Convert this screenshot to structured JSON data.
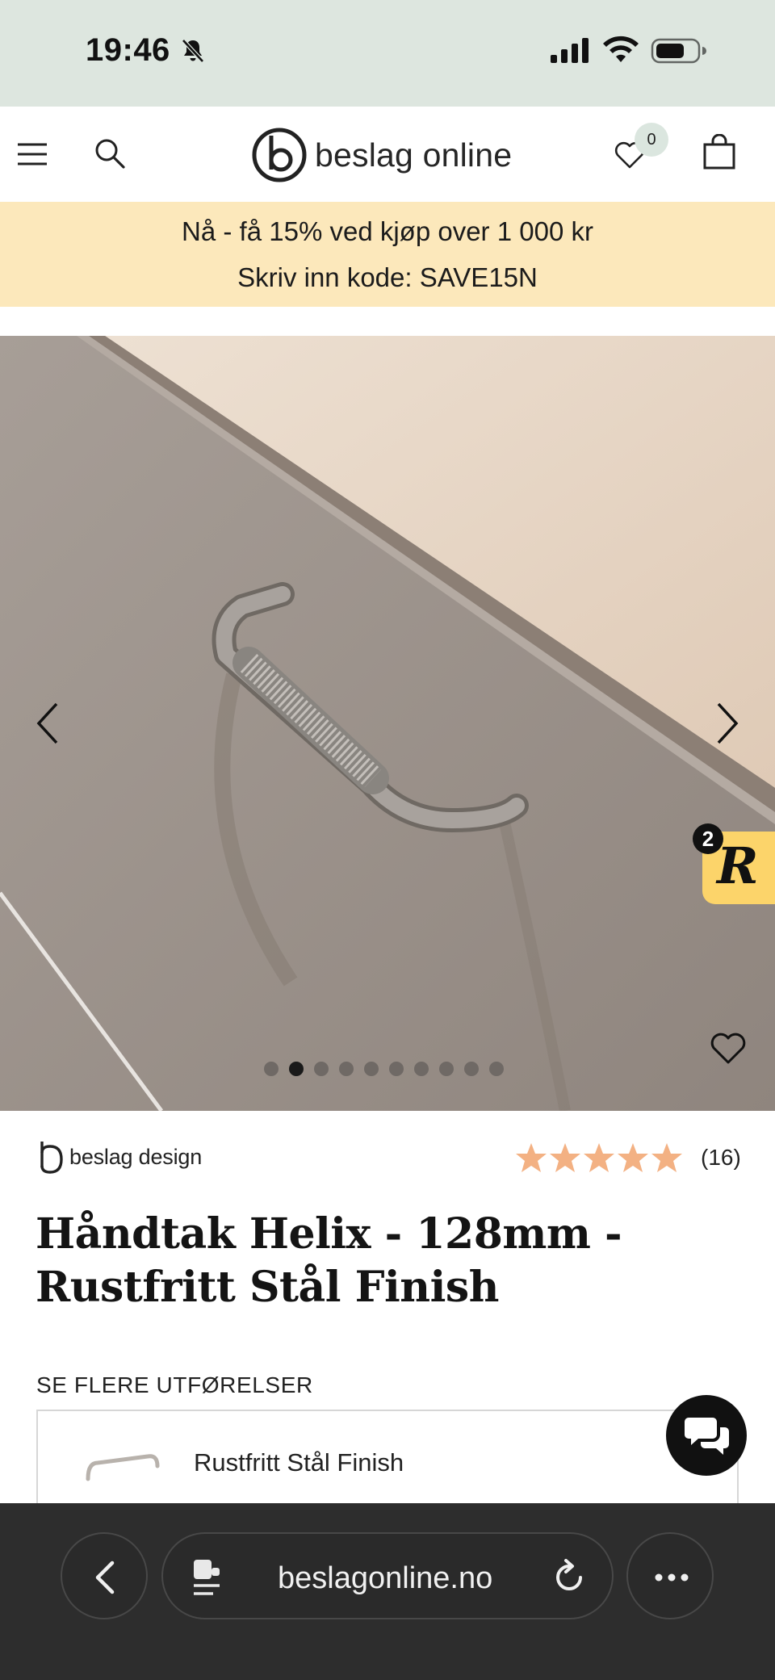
{
  "status_bar": {
    "time": "19:46"
  },
  "header": {
    "logo_text": "beslag online",
    "wishlist_count": "0"
  },
  "promo": {
    "line1": "Nå - få 15% ved kjøp over 1 000 kr",
    "line2": "Skriv inn kode: SAVE15N"
  },
  "gallery": {
    "total_images": 10,
    "active_index": 1,
    "reviews_badge_count": "2",
    "reviews_badge_letter": "R"
  },
  "product": {
    "brand": "beslag design",
    "rating_stars": 5,
    "rating_count": "(16)",
    "title": "Håndtak Helix - 128mm - Rustfritt Stål Finish",
    "variants_label": "SE FLERE UTFØRELSER",
    "selected_variant": "Rustfritt Stål Finish"
  },
  "browser": {
    "url": "beslagonline.no"
  },
  "colors": {
    "status_bg": "#dde6df",
    "promo_bg": "#fce8bb",
    "star": "#f3b183",
    "reviews_tab": "#fcd46a",
    "browser_bg": "#2d2d2d"
  }
}
